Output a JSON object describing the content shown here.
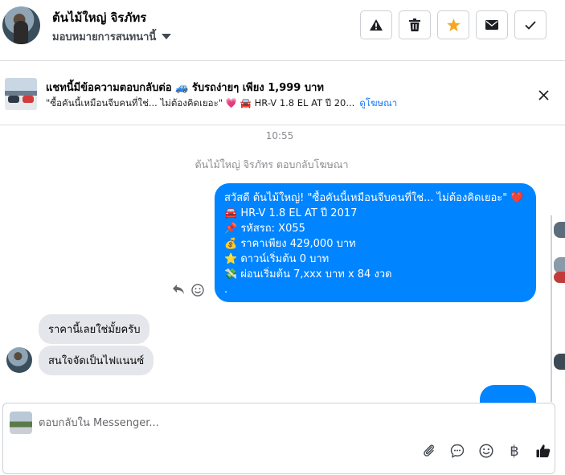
{
  "header": {
    "user_name": "ต้นไม้ใหญ่ จิรภัทร",
    "assign_label": "มอบหมายการสนทนานี้",
    "buttons": [
      "warning-icon",
      "trash-icon",
      "star-icon",
      "envelope-icon",
      "check-icon"
    ],
    "star_color": "#f5a623"
  },
  "ad": {
    "title": "แชทนี้มีข้อความตอบกลับต่อ 🚙 รับรถง่ายๆ เพียง 1,999 บาท",
    "snippet": "\"ซื้อคันนี้เหมือนจีบคนที่ใช่... ไม่ต้องคิดเยอะ\" 💗 🚘 HR-V 1.8 EL AT ปี 20...",
    "link_label": "ดูโฆษณา"
  },
  "thread": {
    "time": "10:55",
    "notice": "ต้นไม้ใหญ่ จิรภัทร ตอบกลับโฆษณา",
    "outgoing_lines": [
      "สวัสดี ต้นไม้ใหญ่! \"ซื้อคันนี้เหมือนจีบคนที่ใช่... ไม่ต้องคิดเยอะ\" ❤️",
      "🚘 HR-V 1.8 EL AT ปี 2017",
      "📌 รหัสรถ: X055",
      "💰 ราคาเพียง 429,000 บาท",
      "⭐ ดาวน์เริ่มต้น 0 บาท",
      "💸 ผ่อนเริ่มต้น 7,xxx บาท x 84 งวด",
      "."
    ],
    "incoming": [
      "ราคานี้เลยใช่มั้ยครับ",
      "สนใจจัดเป็นไฟแนนซ์"
    ],
    "outgoing_color": "#0084ff"
  },
  "composer": {
    "placeholder": "ตอบกลับใน Messenger...",
    "baht_symbol": "฿",
    "tools": [
      "paperclip-icon",
      "chat-bubble-icon",
      "smiley-icon",
      "baht-icon",
      "thumbs-up-icon"
    ]
  }
}
